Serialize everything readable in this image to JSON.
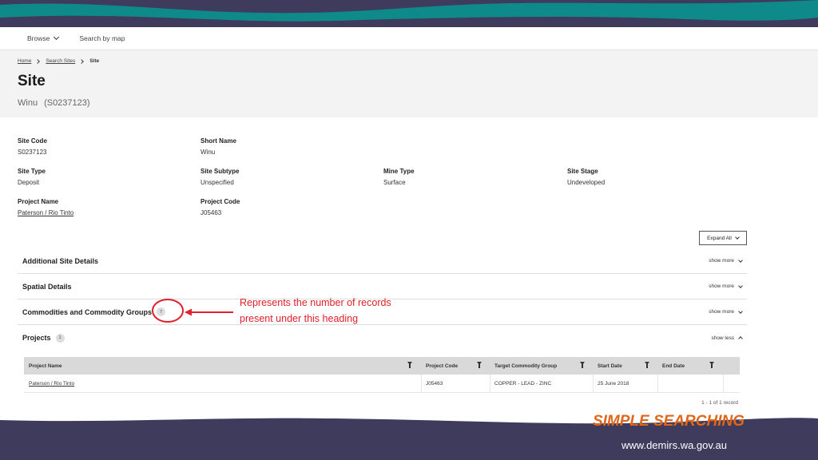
{
  "nav": {
    "browse": "Browse",
    "search_by_map": "Search by map"
  },
  "breadcrumb": {
    "home": "Home",
    "search_sites": "Search Sites",
    "current": "Site"
  },
  "page": {
    "title": "Site",
    "site_name": "Winu",
    "site_code": "(S0237123)"
  },
  "fields": {
    "site_code": {
      "label": "Site Code",
      "value": "S0237123"
    },
    "short_name": {
      "label": "Short Name",
      "value": "Winu"
    },
    "site_type": {
      "label": "Site Type",
      "value": "Deposit"
    },
    "site_subtype": {
      "label": "Site Subtype",
      "value": "Unspecified"
    },
    "mine_type": {
      "label": "Mine Type",
      "value": "Surface"
    },
    "site_stage": {
      "label": "Site Stage",
      "value": "Undeveloped"
    },
    "project_name": {
      "label": "Project Name",
      "value": "Paterson / Rio Tinto"
    },
    "project_code": {
      "label": "Project Code",
      "value": "J05463"
    }
  },
  "expand_all": "Expand All",
  "sections": [
    {
      "title": "Additional Site Details",
      "toggle": "show more"
    },
    {
      "title": "Spatial Details",
      "toggle": "show more"
    },
    {
      "title": "Commodities and Commodity Groups",
      "count": "7",
      "toggle": "show more"
    },
    {
      "title": "Projects",
      "count": "1",
      "toggle": "show less"
    }
  ],
  "table": {
    "headers": [
      "Project Name",
      "Project Code",
      "Target Commodity Group",
      "Start Date",
      "End Date"
    ],
    "rows": [
      [
        "Paterson / Rio Tinto",
        "J05463",
        "COPPER - LEAD - ZINC",
        "25 June 2018",
        ""
      ]
    ],
    "pager": "1 - 1 of 1 record"
  },
  "annotation": {
    "line1": "Represents the number of records",
    "line2": "present under this heading"
  },
  "brand": {
    "title": "SIMPLE SEARCHING",
    "url": "www.demirs.wa.gov.au"
  },
  "colors": {
    "teal": "#0e8a8a",
    "navy": "#3f3b5c",
    "annotation_red": "#e0202a",
    "brand_orange": "#e0661a"
  }
}
